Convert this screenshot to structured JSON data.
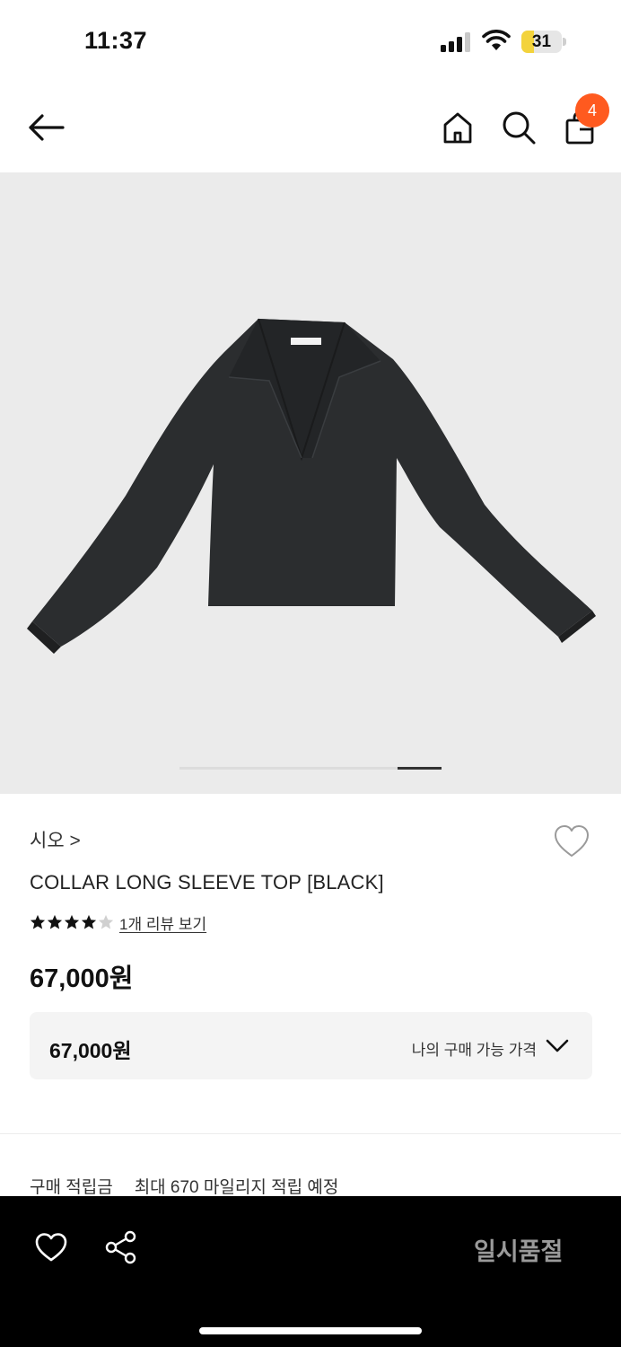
{
  "status_bar": {
    "time": "11:37",
    "battery_level": "31",
    "battery_fraction": 0.31
  },
  "nav": {
    "back_icon": "arrow-left-icon",
    "home_icon": "home-icon",
    "search_icon": "search-icon",
    "bag_icon": "shopping-bag-icon",
    "cart_count": "4"
  },
  "carousel": {
    "image_count": 6,
    "current_index": 6
  },
  "product": {
    "brand": "시오",
    "brand_chevron": ">",
    "name": "COLLAR LONG SLEEVE TOP [BLACK]",
    "rating": 4,
    "rating_max": 5,
    "review_link": "1개 리뷰 보기",
    "price": "67,000원"
  },
  "price_box": {
    "value": "67,000원",
    "label": "나의 구매 가능 가격"
  },
  "mileage": {
    "label": "구매 적립금",
    "value": "최대 670 마일리지 적립 예정"
  },
  "bottom_bar": {
    "wish_icon": "heart-icon",
    "share_icon": "share-icon",
    "cta_label": "일시품절"
  },
  "colors": {
    "badge": "#ff5a1f",
    "battery": "#f3d33c",
    "image_bg": "#ebebeb",
    "bottom_bar": "#000000",
    "cta_text": "#9a9a9a"
  }
}
